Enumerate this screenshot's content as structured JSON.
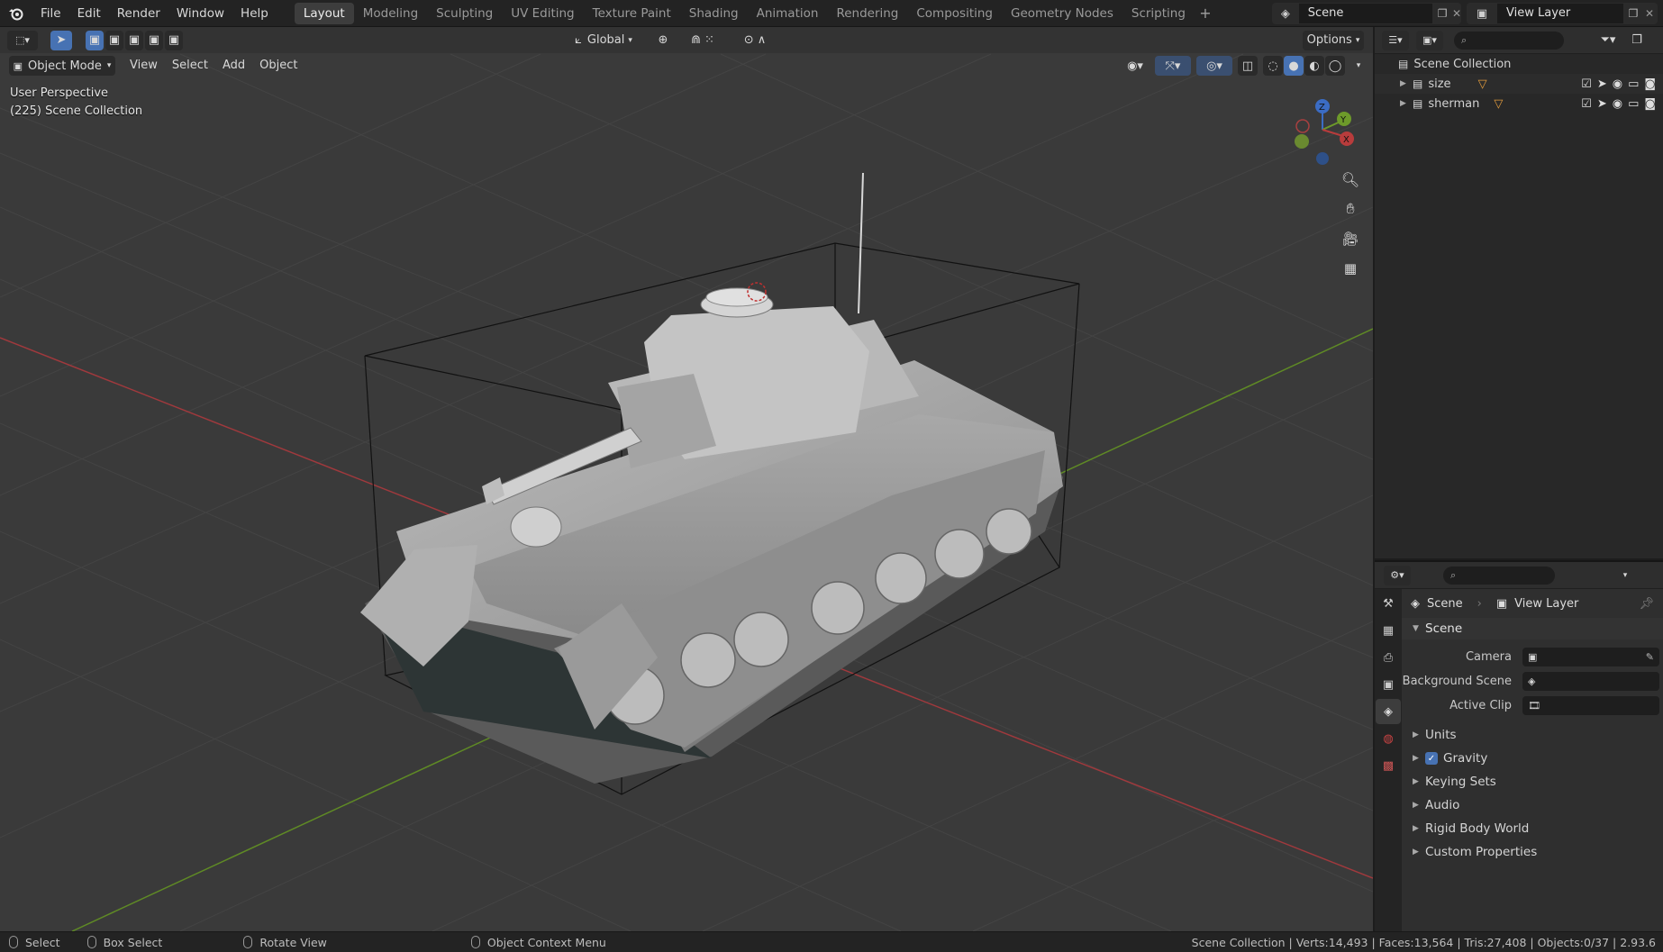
{
  "menu": [
    "File",
    "Edit",
    "Render",
    "Window",
    "Help"
  ],
  "workspaces": [
    "Layout",
    "Modeling",
    "Sculpting",
    "UV Editing",
    "Texture Paint",
    "Shading",
    "Animation",
    "Rendering",
    "Compositing",
    "Geometry Nodes",
    "Scripting"
  ],
  "active_workspace": "Layout",
  "scene_name": "Scene",
  "view_layer_name": "View Layer",
  "viewport": {
    "transform_orientation": "Global",
    "options_label": "Options",
    "mode": "Object Mode",
    "menus": [
      "View",
      "Select",
      "Add",
      "Object"
    ],
    "perspective": "User Perspective",
    "collection_info": "(225) Scene Collection",
    "gizmo_axes": {
      "x": "X",
      "y": "Y",
      "z": "Z"
    }
  },
  "outliner": {
    "root": "Scene Collection",
    "items": [
      {
        "name": "size"
      },
      {
        "name": "sherman"
      }
    ]
  },
  "properties": {
    "crumb_scene": "Scene",
    "crumb_view_layer": "View Layer",
    "section": "Scene",
    "fields": [
      {
        "label": "Camera"
      },
      {
        "label": "Background Scene"
      },
      {
        "label": "Active Clip"
      }
    ],
    "subsections": [
      "Units",
      "Gravity",
      "Keying Sets",
      "Audio",
      "Rigid Body World",
      "Custom Properties"
    ],
    "gravity_checked": true
  },
  "statusbar": {
    "select": "Select",
    "box_select": "Box Select",
    "rotate_view": "Rotate View",
    "context_menu": "Object Context Menu",
    "stats": "Scene Collection | Verts:14,493 | Faces:13,564 | Tris:27,408 | Objects:0/37 | 2.93.6"
  },
  "colors": {
    "accent": "#4772b3",
    "axis_x": "#b83c3c",
    "axis_y": "#6d9a2a",
    "axis_z": "#3b6cc4",
    "viewport_bg": "#3a3a3a"
  }
}
